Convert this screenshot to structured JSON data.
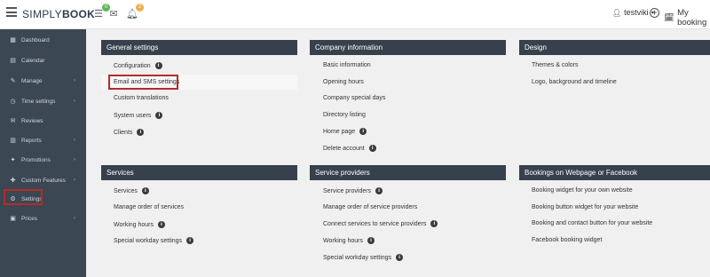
{
  "topbar": {
    "logo_plain": "SIMPLY",
    "logo_bold": "BOOK",
    "tasks_badge": "0",
    "notifications_badge": "2",
    "user_name": "testviki",
    "my_bookings": "My booking"
  },
  "sidebar": {
    "items": [
      {
        "label": "Dashboard",
        "icon": "dashboard-icon"
      },
      {
        "label": "Calendar",
        "icon": "calendar-icon"
      },
      {
        "label": "Manage",
        "icon": "manage-icon"
      },
      {
        "label": "Time settings",
        "icon": "clock-icon"
      },
      {
        "label": "Reviews",
        "icon": "reviews-icon"
      },
      {
        "label": "Reports",
        "icon": "reports-icon"
      },
      {
        "label": "Promotions",
        "icon": "promotions-icon"
      },
      {
        "label": "Custom Features",
        "icon": "puzzle-icon"
      },
      {
        "label": "Settings",
        "icon": "gear-icon"
      },
      {
        "label": "Prices",
        "icon": "prices-icon"
      }
    ]
  },
  "panels": {
    "general": {
      "title": "General settings",
      "links": [
        "Configuration",
        "Email and SMS settings",
        "Custom translations",
        "System users",
        "Clients"
      ]
    },
    "company": {
      "title": "Company information",
      "links": [
        "Basic information",
        "Opening hours",
        "Company special days",
        "Directory listing",
        "Home page",
        "Delete account"
      ]
    },
    "design": {
      "title": "Design",
      "links": [
        "Themes & colors",
        "Logo, background and timeline"
      ]
    },
    "services": {
      "title": "Services",
      "links": [
        "Services",
        "Manage order of services",
        "Working hours",
        "Special workday settings"
      ]
    },
    "providers": {
      "title": "Service providers",
      "links": [
        "Service providers",
        "Manage order of service providers",
        "Connect services to service providers",
        "Working hours",
        "Special workday settings"
      ]
    },
    "booking": {
      "title": "Bookings on Webpage or Facebook",
      "links": [
        "Booking widget for your own website",
        "Booking button widget for your website",
        "Booking and contact button for your website",
        "Facebook booking widget"
      ]
    }
  },
  "colors": {
    "sidebar_bg": "#3b4752",
    "panel_header_bg": "#36414d",
    "highlight_border": "#b52b2b",
    "badge_green": "#5cb85c",
    "badge_orange": "#f0ad4e"
  }
}
